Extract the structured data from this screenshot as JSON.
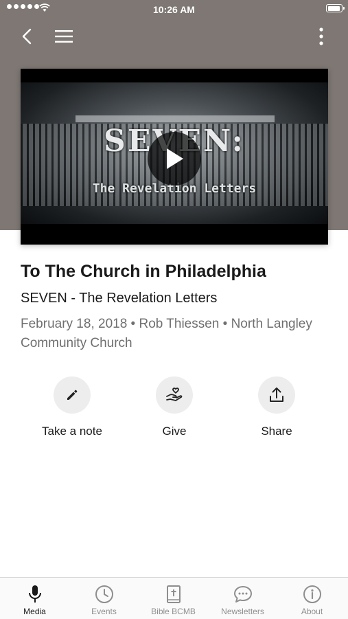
{
  "status_bar": {
    "time": "10:26 AM"
  },
  "video": {
    "thumbnail_title": "SEVEN:",
    "thumbnail_subtitle": "The Revelation Letters"
  },
  "sermon": {
    "title": "To The Church in Philadelphia",
    "series": "SEVEN - The Revelation Letters",
    "meta": "February 18, 2018 • Rob Thiessen • North Langley Community Church"
  },
  "actions": [
    {
      "label": "Take a note",
      "icon": "pencil-icon"
    },
    {
      "label": "Give",
      "icon": "hand-heart-icon"
    },
    {
      "label": "Share",
      "icon": "share-icon"
    }
  ],
  "tabs": [
    {
      "label": "Media",
      "icon": "microphone-icon",
      "active": true
    },
    {
      "label": "Events",
      "icon": "clock-icon",
      "active": false
    },
    {
      "label": "Bible BCMB",
      "icon": "bible-icon",
      "active": false
    },
    {
      "label": "Newsletters",
      "icon": "chat-bubble-icon",
      "active": false
    },
    {
      "label": "About",
      "icon": "info-icon",
      "active": false
    }
  ],
  "colors": {
    "hero_background": "#7e7773",
    "active_tab": "#1a1a1a",
    "inactive_tab": "#8e8e8e"
  },
  "battery_level": 0.92
}
